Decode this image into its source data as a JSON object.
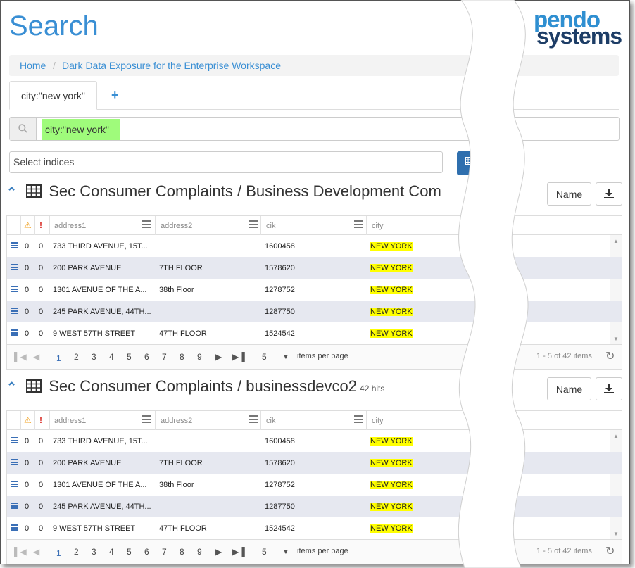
{
  "header": {
    "title": "Search",
    "logo_line1": "pendo",
    "logo_line2": "systems"
  },
  "breadcrumb": {
    "home": "Home",
    "separator": "/",
    "current": "Dark Data Exposure for the Enterprise Workspace"
  },
  "tabs": {
    "active": "city:\"new york\"",
    "add": "+"
  },
  "search": {
    "query": "city:\"new york\""
  },
  "indices": {
    "placeholder": "Select indices"
  },
  "columns": {
    "warn": "⚠",
    "err": "!",
    "c1": "address1",
    "c2": "address2",
    "c3": "cik",
    "c4": "city"
  },
  "rows": [
    {
      "w": "0",
      "e": "0",
      "address1": "733 THIRD AVENUE, 15T...",
      "address2": "",
      "cik": "1600458",
      "city": "NEW YORK"
    },
    {
      "w": "0",
      "e": "0",
      "address1": "200 PARK AVENUE",
      "address2": "7TH FLOOR",
      "cik": "1578620",
      "city": "NEW YORK"
    },
    {
      "w": "0",
      "e": "0",
      "address1": "1301 AVENUE OF THE A...",
      "address2": "38th Floor",
      "cik": "1278752",
      "city": "NEW YORK"
    },
    {
      "w": "0",
      "e": "0",
      "address1": "245 PARK AVENUE, 44TH...",
      "address2": "",
      "cik": "1287750",
      "city": "NEW YORK"
    },
    {
      "w": "0",
      "e": "0",
      "address1": "9 WEST 57TH STREET",
      "address2": "47TH FLOOR",
      "cik": "1524542",
      "city": "NEW YORK"
    }
  ],
  "pager": {
    "pages": [
      "1",
      "2",
      "3",
      "4",
      "5",
      "6",
      "7",
      "8",
      "9"
    ],
    "per_page": "5",
    "per_page_label": "items per page",
    "info": "1 - 5 of 42 items"
  },
  "sections": [
    {
      "title": "Sec Consumer Complaints / Business Development Com",
      "hits": "",
      "name_button": "Name"
    },
    {
      "title": "Sec Consumer Complaints / businessdevco2",
      "hits": "42 hits",
      "name_button": "Name"
    }
  ]
}
